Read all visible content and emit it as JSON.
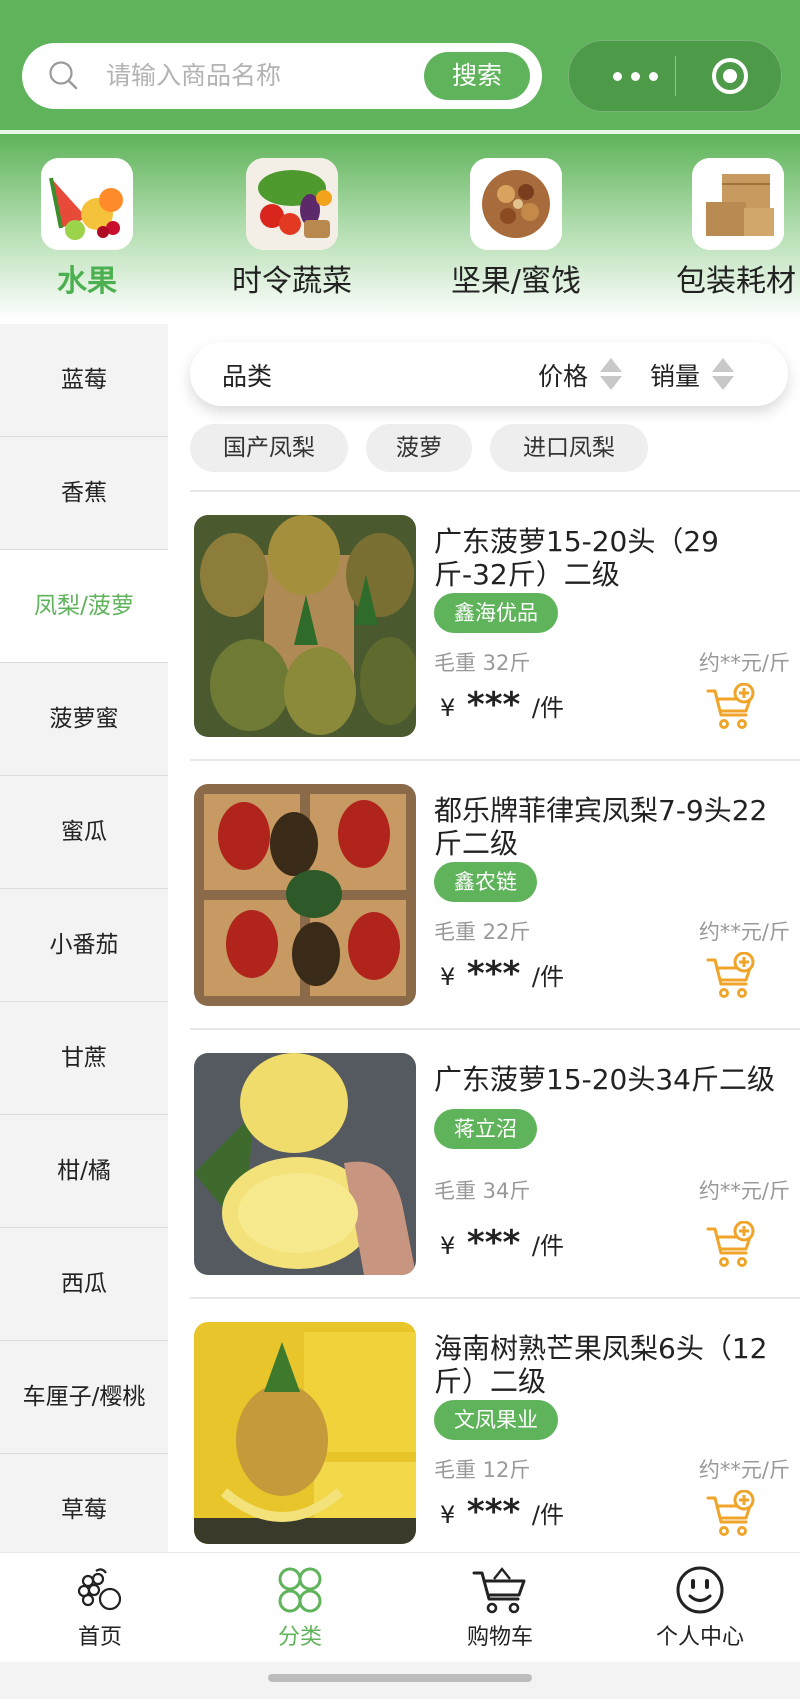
{
  "search": {
    "placeholder": "请输入商品名称",
    "button_label": "搜索"
  },
  "top_categories": [
    {
      "label": "水果",
      "active": true,
      "icon": "fruit-thumbnail"
    },
    {
      "label": "时令蔬菜",
      "active": false,
      "icon": "vegetable-thumbnail"
    },
    {
      "label": "坚果/蜜饯",
      "active": false,
      "icon": "nuts-thumbnail"
    },
    {
      "label": "包装耗材",
      "active": false,
      "icon": "carton-thumbnail"
    }
  ],
  "sidebar": {
    "items": [
      {
        "label": "蓝莓"
      },
      {
        "label": "香蕉"
      },
      {
        "label": "凤梨/菠萝",
        "active": true
      },
      {
        "label": "菠萝蜜"
      },
      {
        "label": "蜜瓜"
      },
      {
        "label": "小番茄"
      },
      {
        "label": "甘蔗"
      },
      {
        "label": "柑/橘"
      },
      {
        "label": "西瓜"
      },
      {
        "label": "车厘子/樱桃"
      },
      {
        "label": "草莓"
      }
    ]
  },
  "sort": {
    "category_label": "品类",
    "price_label": "价格",
    "sales_label": "销量"
  },
  "chips": [
    "国产凤梨",
    "菠萝",
    "进口凤梨"
  ],
  "products": [
    {
      "title": "广东菠萝15-20头（29斤-32斤）二级",
      "supplier": "鑫海优品",
      "weight": "毛重 32斤",
      "unit_price": "约**元/斤",
      "currency": "¥",
      "price": "***",
      "unit": "/件"
    },
    {
      "title": "都乐牌菲律宾凤梨7-9头22斤二级",
      "supplier": "鑫农链",
      "weight": "毛重 22斤",
      "unit_price": "约**元/斤",
      "currency": "¥",
      "price": "***",
      "unit": "/件"
    },
    {
      "title": "广东菠萝15-20头34斤二级",
      "supplier": "蒋立沼",
      "weight": "毛重 34斤",
      "unit_price": "约**元/斤",
      "currency": "¥",
      "price": "***",
      "unit": "/件"
    },
    {
      "title": "海南树熟芒果凤梨6头（12斤）二级",
      "supplier": "文凤果业",
      "weight": "毛重 12斤",
      "unit_price": "约**元/斤",
      "currency": "¥",
      "price": "***",
      "unit": "/件"
    }
  ],
  "tabbar": [
    {
      "label": "首页",
      "icon": "grapes-icon"
    },
    {
      "label": "分类",
      "icon": "clover-icon",
      "active": true
    },
    {
      "label": "购物车",
      "icon": "cart-icon"
    },
    {
      "label": "个人中心",
      "icon": "smiley-icon"
    }
  ],
  "colors": {
    "brand_green": "#5fb35a",
    "cart_orange": "#f0a52a"
  }
}
